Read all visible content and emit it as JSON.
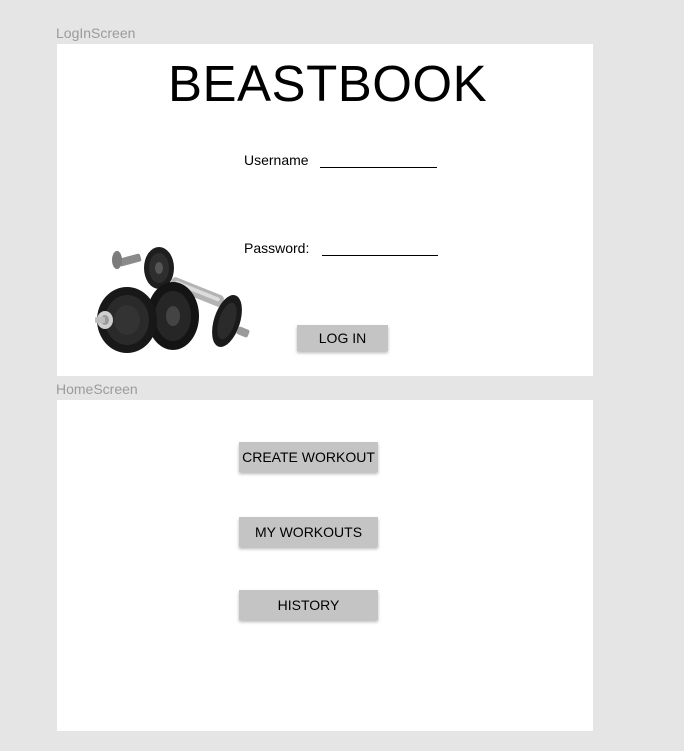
{
  "frames": {
    "login_label": "LogInScreen",
    "home_label": "HomeScreen"
  },
  "login": {
    "title": "BEASTBOOK",
    "username_label": "Username",
    "password_label": "Password:",
    "login_button": "LOG IN",
    "image": "dumbbells-image"
  },
  "home": {
    "buttons": [
      {
        "label": "CREATE WORKOUT"
      },
      {
        "label": "MY WORKOUTS"
      },
      {
        "label": "HISTORY"
      }
    ]
  },
  "colors": {
    "canvas_bg": "#e5e5e5",
    "frame_bg": "#ffffff",
    "button_bg": "#c4c4c4",
    "frame_label": "#9b9b9b"
  }
}
